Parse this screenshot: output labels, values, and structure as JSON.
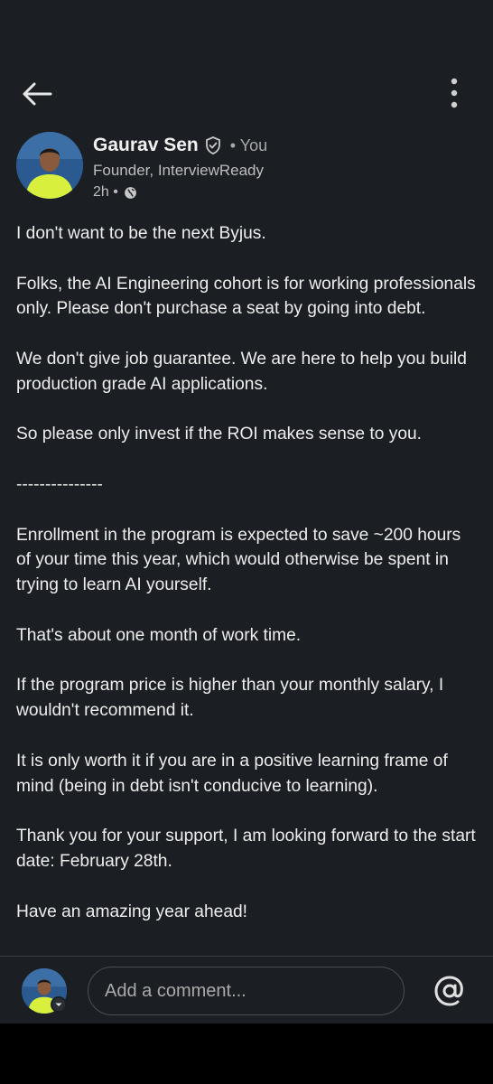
{
  "header": {
    "back_icon": "arrow-left-icon",
    "more_icon": "more-vertical-icon"
  },
  "author": {
    "name": "Gaurav Sen",
    "verified_icon": "verified-shield-icon",
    "relation": "• You",
    "headline": "Founder, InterviewReady",
    "time": "2h •",
    "visibility_icon": "globe-icon"
  },
  "post": {
    "paragraphs": [
      "I don't want to be the next Byjus.",
      "Folks, the AI Engineering cohort is for working professionals only. Please don't purchase a seat by going into debt.",
      "We don't give job guarantee. We are here to help you build production grade AI applications.",
      "So please only invest if the ROI makes sense to you.",
      "---------------",
      "Enrollment in the program is expected to save ~200 hours of your time this year, which would otherwise be spent in trying to learn AI yourself.",
      "That's about one month of work time.",
      "If the program price is higher than your monthly salary, I wouldn't recommend it.",
      "It is only worth it if you are in a positive learning frame of mind (being in debt isn't conducive to learning).",
      "Thank you for your support, I am looking forward to the start date: February 28th.",
      "Have an amazing year ahead!"
    ]
  },
  "comment": {
    "placeholder": "Add a comment...",
    "mention_icon": "at-sign-icon"
  },
  "colors": {
    "background": "#1b1f23",
    "text": "#ededed",
    "secondary_text": "#bdbdbd",
    "avatar_bg": "#2a5a8f",
    "shirt": "#d9ef3d"
  }
}
